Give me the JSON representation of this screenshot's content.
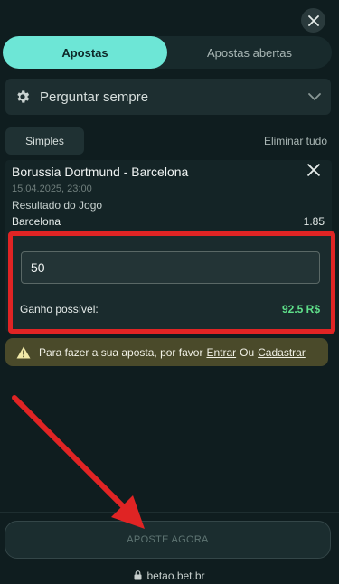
{
  "tabs": [
    {
      "label": "Apostas",
      "active": true
    },
    {
      "label": "Apostas abertas",
      "active": false
    }
  ],
  "settings": {
    "label": "Perguntar sempre"
  },
  "bet_type": {
    "label": "Simples",
    "remove_all": "Eliminar tudo"
  },
  "bet": {
    "match": "Borussia Dortmund - Barcelona",
    "date": "15.04.2025, 23:00",
    "market": "Resultado do Jogo",
    "selection": "Barcelona",
    "odds": "1.85",
    "stake": "50",
    "gain_label": "Ganho possível:",
    "gain_value": "92.5 R$"
  },
  "warning": {
    "text": "Para fazer a sua aposta, por favor",
    "login": "Entrar",
    "or": "Ou",
    "register": "Cadastrar"
  },
  "place_bet": {
    "label": "APOSTE AGORA"
  },
  "url": "betao.bet.br",
  "colors": {
    "accent": "#6de6d6",
    "highlight": "#e02424",
    "gain": "#5fe08a",
    "background": "#0f1d1f"
  },
  "icons": [
    "close-icon",
    "gear-icon",
    "chevron-down-icon",
    "warning-icon",
    "lock-icon",
    "arrow-annotation"
  ]
}
